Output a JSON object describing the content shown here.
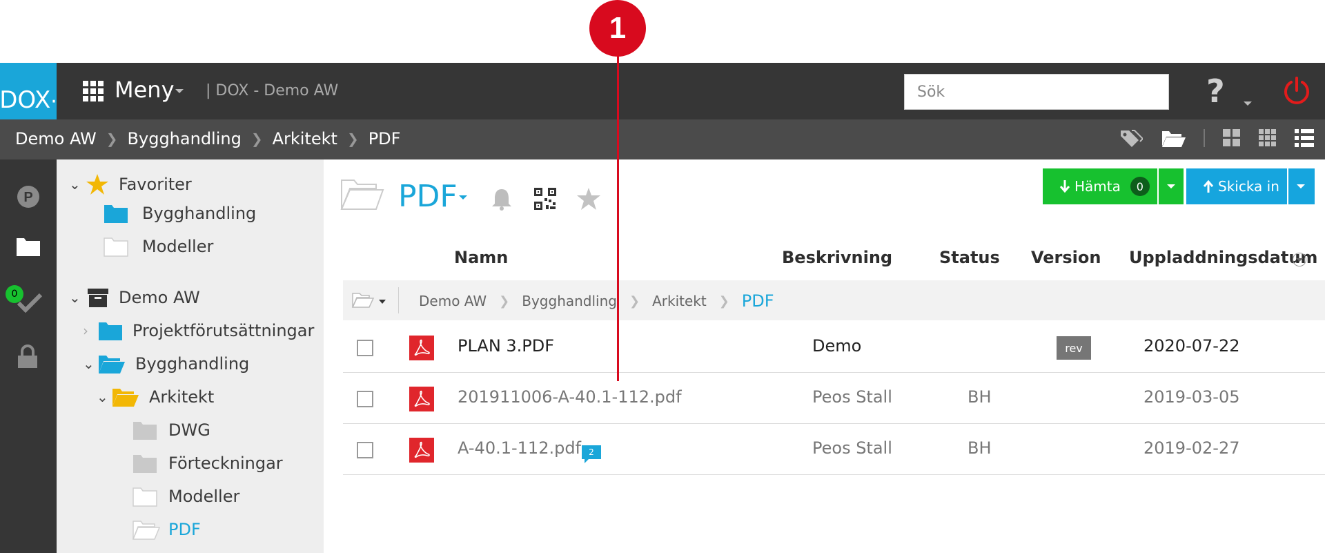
{
  "annotation": {
    "number": "1"
  },
  "app": {
    "logo": "DOX",
    "menu_label": "Meny",
    "project_label": "| DOX - Demo AW",
    "search_placeholder": "Sök",
    "help_symbol": "?"
  },
  "breadcrumb": [
    "Demo AW",
    "Bygghandling",
    "Arkitekt",
    "PDF"
  ],
  "rail": {
    "tasks_count": "0"
  },
  "tree": {
    "favorites": {
      "label": "Favoriter",
      "items": [
        "Bygghandling",
        "Modeller"
      ]
    },
    "project": {
      "label": "Demo AW",
      "items": [
        {
          "label": "Projektförutsättningar"
        },
        {
          "label": "Bygghandling"
        },
        {
          "label": "Arkitekt"
        },
        {
          "label": "DWG"
        },
        {
          "label": "Förteckningar"
        },
        {
          "label": "Modeller"
        },
        {
          "label": "PDF"
        }
      ]
    }
  },
  "main": {
    "folder_title": "PDF",
    "download_label": "Hämta",
    "download_count": "0",
    "upload_label": "Skicka in",
    "columns": {
      "name": "Namn",
      "description": "Beskrivning",
      "status": "Status",
      "version": "Version",
      "upload_date": "Uppladdningsdatum"
    },
    "path": [
      "Demo AW",
      "Bygghandling",
      "Arkitekt",
      "PDF"
    ],
    "files": [
      {
        "name": "PLAN 3.PDF",
        "description": "Demo",
        "status": "",
        "version": "rev",
        "date": "2020-07-22",
        "comments": ""
      },
      {
        "name": "201911006-A-40.1-112.pdf",
        "description": "Peos Stall",
        "status": "BH",
        "version": "",
        "date": "2019-03-05",
        "comments": ""
      },
      {
        "name": "A-40.1-112.pdf",
        "description": "Peos Stall",
        "status": "BH",
        "version": "",
        "date": "2019-02-27",
        "comments": "2"
      }
    ]
  },
  "colors": {
    "accent": "#1aa6d9",
    "download_green": "#17c12f",
    "annotation_red": "#d80a1e",
    "topbar": "#363636",
    "pdf_red": "#e0262c"
  }
}
